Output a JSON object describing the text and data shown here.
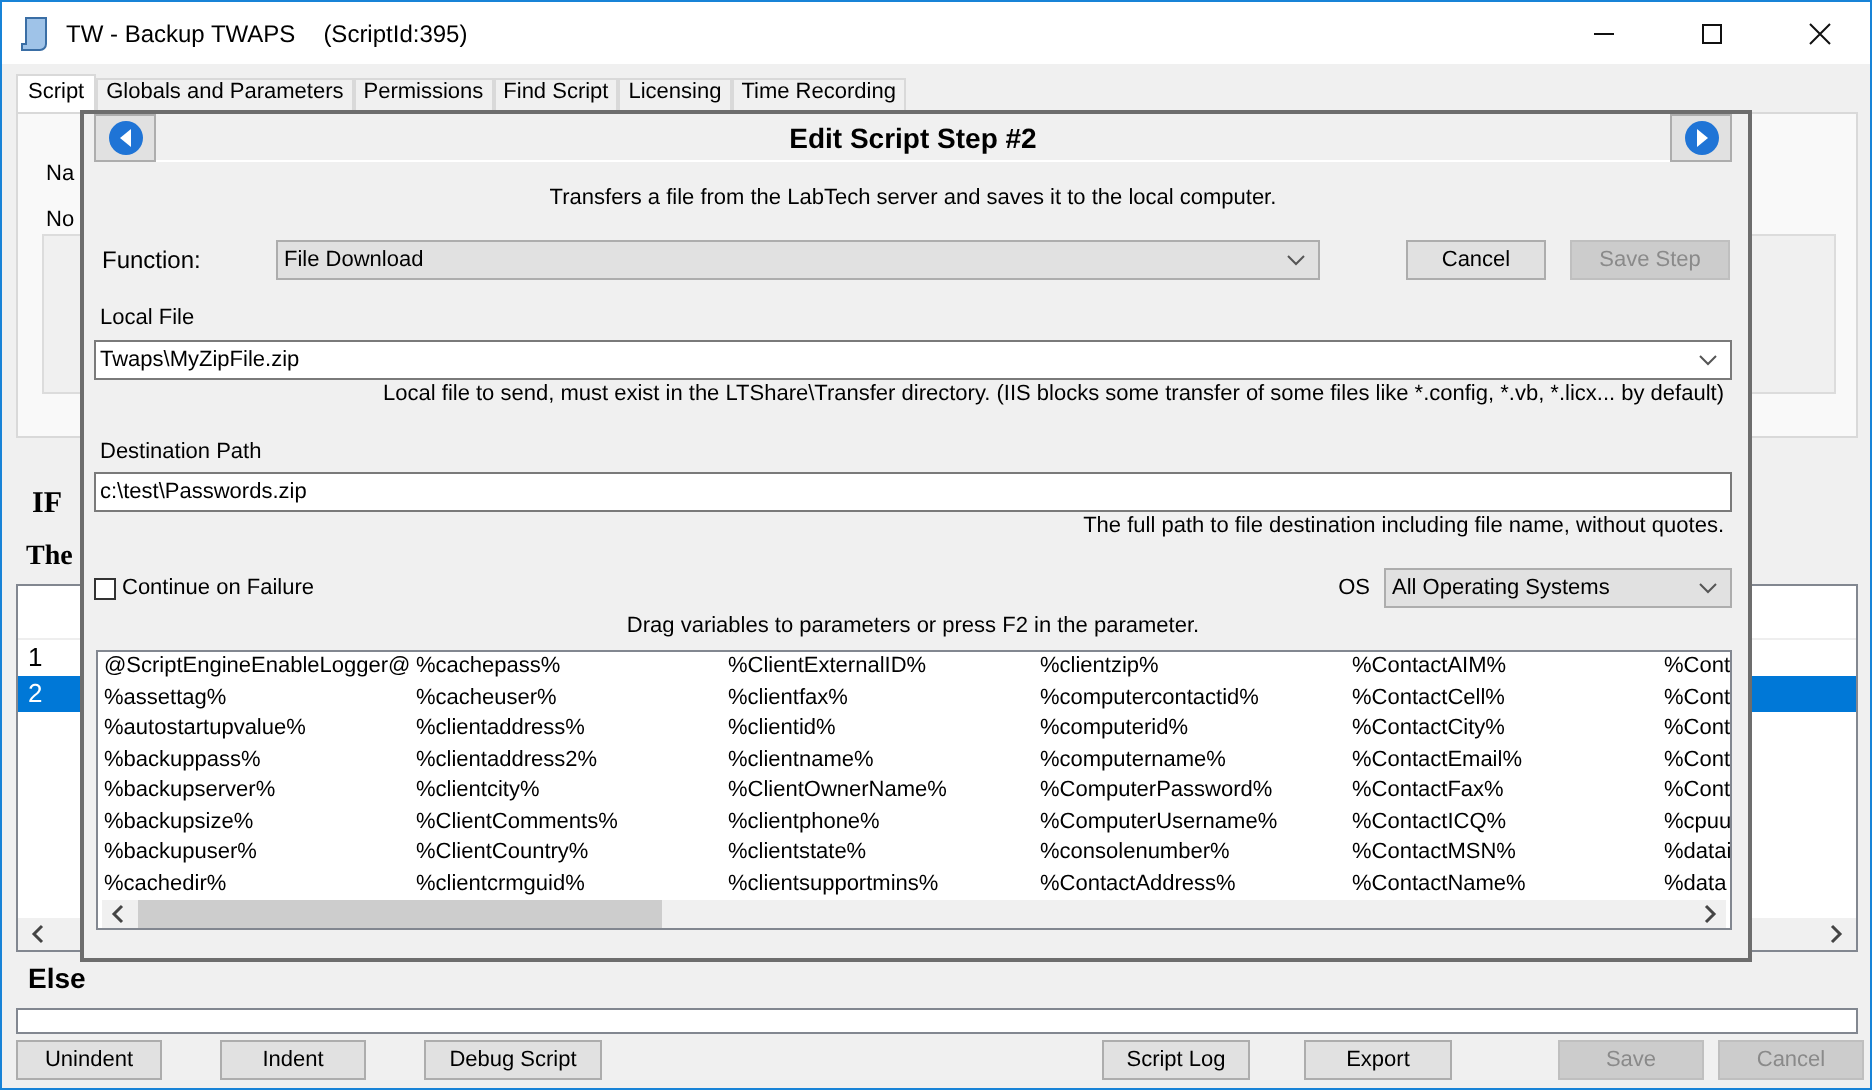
{
  "window": {
    "title": "TW - Backup TWAPS",
    "script_id": "(ScriptId:395)"
  },
  "tabs": [
    {
      "label": "Script",
      "selected": true
    },
    {
      "label": "Globals and Parameters",
      "selected": false
    },
    {
      "label": "Permissions",
      "selected": false
    },
    {
      "label": "Find Script",
      "selected": false
    },
    {
      "label": "Licensing",
      "selected": false
    },
    {
      "label": "Time Recording",
      "selected": false
    }
  ],
  "script_panel": {
    "labels": [
      "Na",
      "No"
    ]
  },
  "if_label": "IF",
  "then_label": "The",
  "steps": {
    "rows": [
      {
        "number": "1",
        "selected": false
      },
      {
        "number": "2",
        "selected": true
      }
    ]
  },
  "else_label": "Else",
  "buttons": {
    "left": [
      {
        "label": "Unindent",
        "disabled": false
      },
      {
        "label": "Indent",
        "disabled": false
      },
      {
        "label": "Debug Script",
        "disabled": false
      }
    ],
    "middle": [
      {
        "label": "Script Log",
        "disabled": false
      },
      {
        "label": "Export",
        "disabled": false
      }
    ],
    "right": [
      {
        "label": "Save",
        "disabled": true
      },
      {
        "label": "Cancel",
        "disabled": true
      }
    ]
  },
  "dialog": {
    "title": "Edit Script Step #2",
    "description": "Transfers a file from the LabTech server and saves it to the local computer.",
    "function_label": "Function:",
    "function_value": "File Download",
    "cancel_button": {
      "label": "Cancel",
      "disabled": false
    },
    "save_step_button": {
      "label": "Save Step",
      "disabled": true
    },
    "local_file": {
      "label": "Local File",
      "value": "Twaps\\MyZipFile.zip",
      "help": "Local file to send, must exist in the LTShare\\Transfer directory.  (IIS blocks some transfer of some files like *.config, *.vb, *.licx... by default)"
    },
    "destination": {
      "label": "Destination Path",
      "value": "c:\\test\\Passwords.zip",
      "help": "The full path to file destination including file name, without quotes."
    },
    "continue_on_failure": {
      "label": "Continue on Failure",
      "checked": false
    },
    "os_label": "OS",
    "os_value": "All Operating Systems",
    "drag_hint": "Drag variables to parameters or press F2 in the parameter.",
    "variable_columns": [
      [
        "@ScriptEngineEnableLogger@",
        "%assettag%",
        "%autostartupvalue%",
        "%backuppass%",
        "%backupserver%",
        "%backupsize%",
        "%backupuser%",
        "%cachedir%"
      ],
      [
        "%cachepass%",
        "%cacheuser%",
        "%clientaddress%",
        "%clientaddress2%",
        "%clientcity%",
        "%ClientComments%",
        "%ClientCountry%",
        "%clientcrmguid%"
      ],
      [
        "%ClientExternalID%",
        "%clientfax%",
        "%clientid%",
        "%clientname%",
        "%ClientOwnerName%",
        "%clientphone%",
        "%clientstate%",
        "%clientsupportmins%"
      ],
      [
        "%clientzip%",
        "%computercontactid%",
        "%computerid%",
        "%computername%",
        "%ComputerPassword%",
        "%ComputerUsername%",
        "%consolenumber%",
        "%ContactAddress%"
      ],
      [
        "%ContactAIM%",
        "%ContactCell%",
        "%ContactCity%",
        "%ContactEmail%",
        "%ContactFax%",
        "%ContactICQ%",
        "%ContactMSN%",
        "%ContactName%"
      ],
      [
        "%Cont",
        "%Cont",
        "%Cont",
        "%Cont",
        "%Cont",
        "%cpuu",
        "%datai",
        "%data"
      ]
    ]
  }
}
